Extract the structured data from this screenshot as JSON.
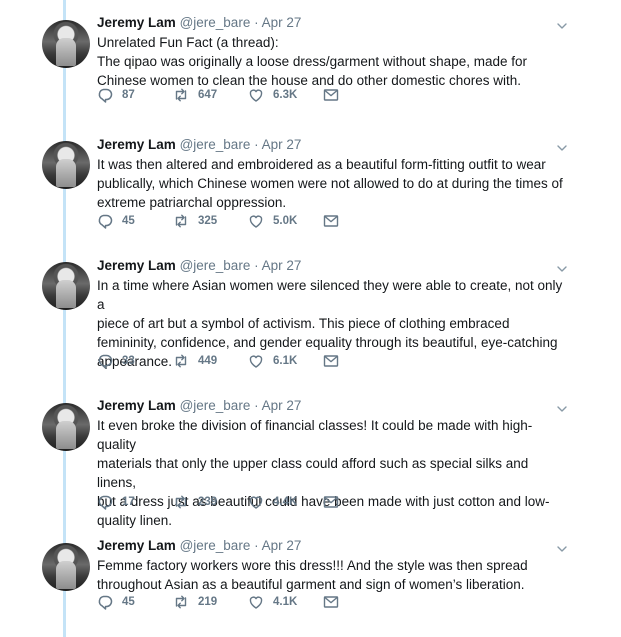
{
  "tweets": [
    {
      "name": "Jeremy Lam",
      "handle": "@jere_bare",
      "separator": "·",
      "date": "Apr 27",
      "lines": [
        "Unrelated Fun Fact (a thread):",
        "The qipao was originally a loose dress/garment without shape, made for",
        "Chinese women to clean the house and do other domestic chores with."
      ],
      "replies": "87",
      "retweets": "647",
      "likes": "6.3K"
    },
    {
      "name": "Jeremy Lam",
      "handle": "@jere_bare",
      "separator": "·",
      "date": "Apr 27",
      "lines": [
        "It was then altered and embroidered as a beautiful form-fitting outfit to wear",
        "publically, which Chinese women were not allowed to do at during the times of",
        "extreme patriarchal oppression."
      ],
      "replies": "45",
      "retweets": "325",
      "likes": "5.0K"
    },
    {
      "name": "Jeremy Lam",
      "handle": "@jere_bare",
      "separator": "·",
      "date": "Apr 27",
      "lines": [
        "In a time where Asian women were silenced they were able to create, not only a",
        "piece of art but a symbol of activism. This piece of clothing embraced",
        "femininity, confidence, and gender equality through its beautiful, eye-catching",
        "appearance."
      ],
      "replies": "33",
      "retweets": "449",
      "likes": "6.1K"
    },
    {
      "name": "Jeremy Lam",
      "handle": "@jere_bare",
      "separator": "·",
      "date": "Apr 27",
      "lines": [
        "It even broke the division of financial classes! It could be made with high-quality",
        "materials that only the upper class could afford such as special silks and linens,",
        "but a dress just as beautiful could have been made with just cotton and low-",
        "quality linen."
      ],
      "replies": "17",
      "retweets": "239",
      "likes": "4.4K"
    },
    {
      "name": "Jeremy Lam",
      "handle": "@jere_bare",
      "separator": "·",
      "date": "Apr 27",
      "lines": [
        "Femme factory workers wore this dress!!! And the style was then spread",
        "throughout Asian as a beautiful garment and sign of women’s liberation."
      ],
      "replies": "45",
      "retweets": "219",
      "likes": "4.1K"
    }
  ],
  "icons": {
    "reply": "reply-icon",
    "retweet": "retweet-icon",
    "like": "heart-icon",
    "dm": "envelope-icon",
    "caret": "chevron-down-icon"
  },
  "colors": {
    "thread_line": "#c4e3f7",
    "meta_text": "#657786",
    "body_text": "#14171a"
  }
}
